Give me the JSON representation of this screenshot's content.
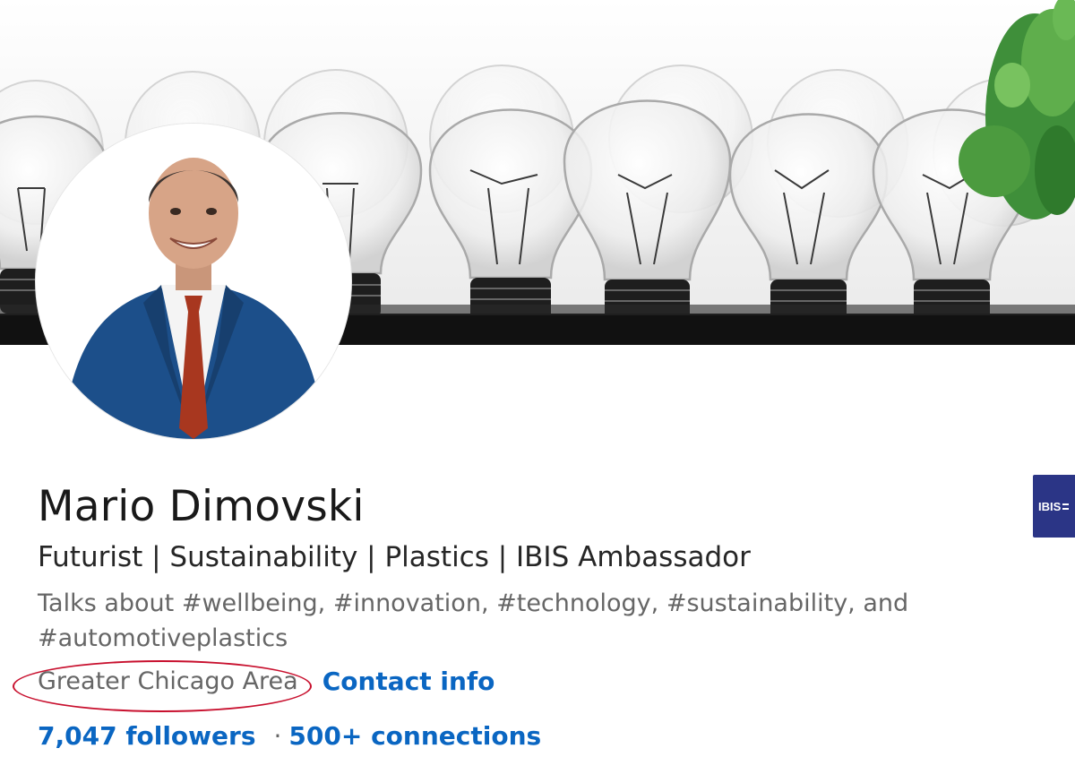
{
  "profile": {
    "name": "Mario Dimovski",
    "headline": "Futurist | Sustainability | Plastics | IBIS Ambassador",
    "talks_about": "Talks about #wellbeing, #innovation, #technology, #sustainability, and #automotiveplastics",
    "location": "Greater Chicago Area",
    "contact_info_label": "Contact info",
    "followers": "7,047 followers",
    "separator": "·",
    "connections": "500+ connections"
  },
  "company_chip": {
    "label": "IBIS"
  },
  "banner": {
    "icon": "light-bulbs-banner",
    "accent_plant": "green-plant"
  },
  "colors": {
    "link": "#0a66c2",
    "annotation_circle": "#c8102e",
    "company_chip_bg": "#2b3586"
  }
}
